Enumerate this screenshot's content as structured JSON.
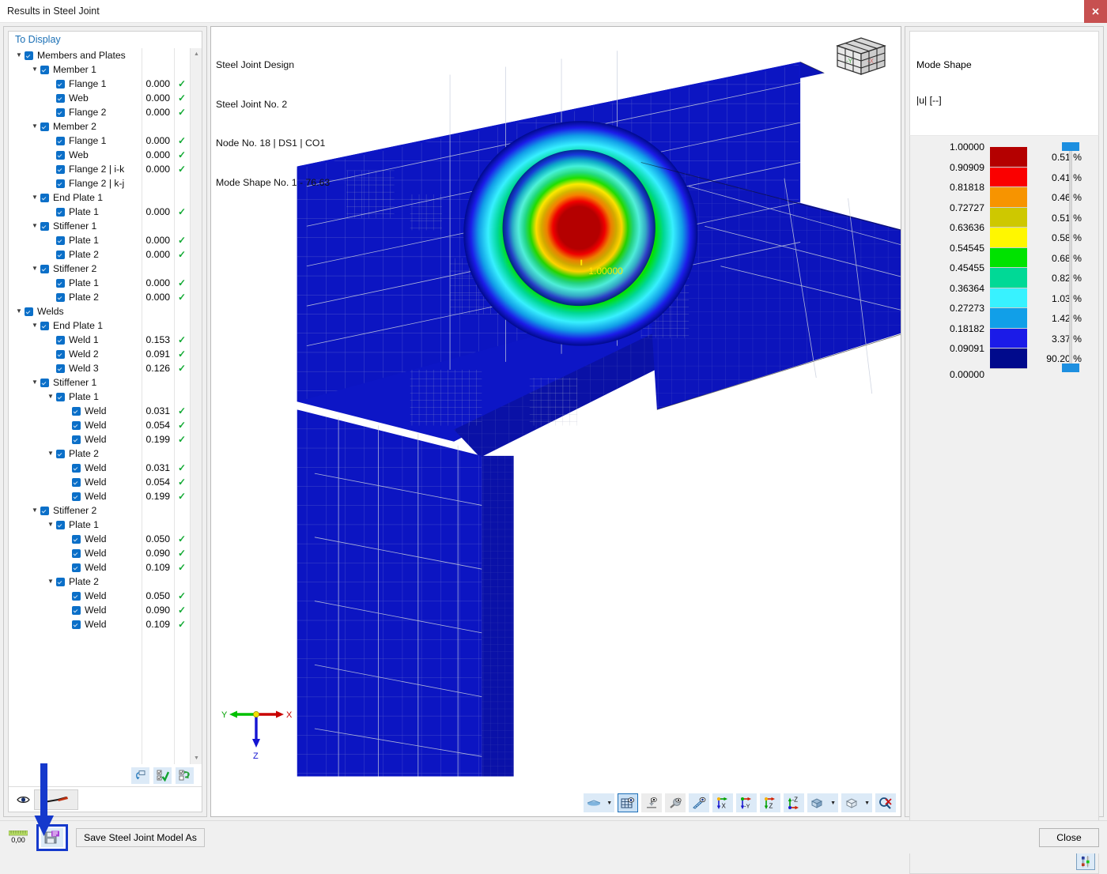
{
  "window": {
    "title": "Results in Steel Joint",
    "close_icon": "close-icon"
  },
  "left_panel": {
    "header": "To Display",
    "tree": [
      {
        "indent": 0,
        "twist": "v",
        "check": true,
        "label": "Members and Plates",
        "value": "",
        "ok": false
      },
      {
        "indent": 1,
        "twist": "v",
        "check": true,
        "label": "Member 1",
        "value": "",
        "ok": false
      },
      {
        "indent": 2,
        "twist": "",
        "check": true,
        "label": "Flange 1",
        "value": "0.000",
        "ok": true
      },
      {
        "indent": 2,
        "twist": "",
        "check": true,
        "label": "Web",
        "value": "0.000",
        "ok": true
      },
      {
        "indent": 2,
        "twist": "",
        "check": true,
        "label": "Flange 2",
        "value": "0.000",
        "ok": true
      },
      {
        "indent": 1,
        "twist": "v",
        "check": true,
        "label": "Member 2",
        "value": "",
        "ok": false
      },
      {
        "indent": 2,
        "twist": "",
        "check": true,
        "label": "Flange 1",
        "value": "0.000",
        "ok": true
      },
      {
        "indent": 2,
        "twist": "",
        "check": true,
        "label": "Web",
        "value": "0.000",
        "ok": true
      },
      {
        "indent": 2,
        "twist": "",
        "check": true,
        "label": "Flange 2 | i-k",
        "value": "0.000",
        "ok": true
      },
      {
        "indent": 2,
        "twist": "",
        "check": true,
        "label": "Flange 2 | k-j",
        "value": "",
        "ok": false
      },
      {
        "indent": 1,
        "twist": "v",
        "check": true,
        "label": "End Plate 1",
        "value": "",
        "ok": false
      },
      {
        "indent": 2,
        "twist": "",
        "check": true,
        "label": "Plate 1",
        "value": "0.000",
        "ok": true
      },
      {
        "indent": 1,
        "twist": "v",
        "check": true,
        "label": "Stiffener 1",
        "value": "",
        "ok": false
      },
      {
        "indent": 2,
        "twist": "",
        "check": true,
        "label": "Plate 1",
        "value": "0.000",
        "ok": true
      },
      {
        "indent": 2,
        "twist": "",
        "check": true,
        "label": "Plate 2",
        "value": "0.000",
        "ok": true
      },
      {
        "indent": 1,
        "twist": "v",
        "check": true,
        "label": "Stiffener 2",
        "value": "",
        "ok": false
      },
      {
        "indent": 2,
        "twist": "",
        "check": true,
        "label": "Plate 1",
        "value": "0.000",
        "ok": true
      },
      {
        "indent": 2,
        "twist": "",
        "check": true,
        "label": "Plate 2",
        "value": "0.000",
        "ok": true
      },
      {
        "indent": 0,
        "twist": "v",
        "check": true,
        "label": "Welds",
        "value": "",
        "ok": false
      },
      {
        "indent": 1,
        "twist": "v",
        "check": true,
        "label": "End Plate 1",
        "value": "",
        "ok": false
      },
      {
        "indent": 2,
        "twist": "",
        "check": true,
        "label": "Weld 1",
        "value": "0.153",
        "ok": true
      },
      {
        "indent": 2,
        "twist": "",
        "check": true,
        "label": "Weld 2",
        "value": "0.091",
        "ok": true
      },
      {
        "indent": 2,
        "twist": "",
        "check": true,
        "label": "Weld 3",
        "value": "0.126",
        "ok": true
      },
      {
        "indent": 1,
        "twist": "v",
        "check": true,
        "label": "Stiffener 1",
        "value": "",
        "ok": false
      },
      {
        "indent": 2,
        "twist": "v",
        "check": true,
        "label": "Plate 1",
        "value": "",
        "ok": false
      },
      {
        "indent": 3,
        "twist": "",
        "check": true,
        "label": "Weld",
        "value": "0.031",
        "ok": true
      },
      {
        "indent": 3,
        "twist": "",
        "check": true,
        "label": "Weld",
        "value": "0.054",
        "ok": true
      },
      {
        "indent": 3,
        "twist": "",
        "check": true,
        "label": "Weld",
        "value": "0.199",
        "ok": true
      },
      {
        "indent": 2,
        "twist": "v",
        "check": true,
        "label": "Plate 2",
        "value": "",
        "ok": false
      },
      {
        "indent": 3,
        "twist": "",
        "check": true,
        "label": "Weld",
        "value": "0.031",
        "ok": true
      },
      {
        "indent": 3,
        "twist": "",
        "check": true,
        "label": "Weld",
        "value": "0.054",
        "ok": true
      },
      {
        "indent": 3,
        "twist": "",
        "check": true,
        "label": "Weld",
        "value": "0.199",
        "ok": true
      },
      {
        "indent": 1,
        "twist": "v",
        "check": true,
        "label": "Stiffener 2",
        "value": "",
        "ok": false
      },
      {
        "indent": 2,
        "twist": "v",
        "check": true,
        "label": "Plate 1",
        "value": "",
        "ok": false
      },
      {
        "indent": 3,
        "twist": "",
        "check": true,
        "label": "Weld",
        "value": "0.050",
        "ok": true
      },
      {
        "indent": 3,
        "twist": "",
        "check": true,
        "label": "Weld",
        "value": "0.090",
        "ok": true
      },
      {
        "indent": 3,
        "twist": "",
        "check": true,
        "label": "Weld",
        "value": "0.109",
        "ok": true
      },
      {
        "indent": 2,
        "twist": "v",
        "check": true,
        "label": "Plate 2",
        "value": "",
        "ok": false
      },
      {
        "indent": 3,
        "twist": "",
        "check": true,
        "label": "Weld",
        "value": "0.050",
        "ok": true
      },
      {
        "indent": 3,
        "twist": "",
        "check": true,
        "label": "Weld",
        "value": "0.090",
        "ok": true
      },
      {
        "indent": 3,
        "twist": "",
        "check": true,
        "label": "Weld",
        "value": "0.109",
        "ok": true
      }
    ],
    "tools": [
      {
        "name": "reset-view-button",
        "icon": "reset-arrow-icon"
      },
      {
        "name": "select-all-button",
        "icon": "check-all-icon"
      },
      {
        "name": "invert-selection-button",
        "icon": "invert-selection-icon"
      }
    ],
    "footer": {
      "eye_icon": "visibility-eye-icon",
      "swatch_name": "weld-symbol-preview"
    }
  },
  "viewport": {
    "header_lines": [
      "Steel Joint Design",
      "Steel Joint No. 2",
      "Node No. 18 | DS1 | CO1",
      "Mode Shape No. 1 - 76.63"
    ],
    "peak_label": "1.00000",
    "nav_cube": {
      "label_x": "-X",
      "label_y": "-Y"
    },
    "axes": {
      "x": "X",
      "y": "Y",
      "z": "Z"
    },
    "toolbar": [
      {
        "name": "render-mode-button",
        "icon": "shading-icon",
        "caret": true,
        "selected": false,
        "flat": false
      },
      {
        "name": "show-mesh-button",
        "icon": "mesh-grid-icon",
        "caret": false,
        "selected": true,
        "flat": false
      },
      {
        "name": "show-supports-button",
        "icon": "support-icon",
        "caret": false,
        "selected": false,
        "flat": true
      },
      {
        "name": "show-loads-button",
        "icon": "load-pin-icon",
        "caret": false,
        "selected": false,
        "flat": true
      },
      {
        "name": "show-dimensions-button",
        "icon": "ruler-eye-icon",
        "caret": false,
        "selected": false,
        "flat": false
      },
      {
        "name": "view-in-x-button",
        "icon": "axis-x-icon",
        "caret": false,
        "selected": false,
        "flat": false
      },
      {
        "name": "view-in-negative-y-button",
        "icon": "axis-neg-y-icon",
        "caret": false,
        "selected": false,
        "flat": false
      },
      {
        "name": "view-in-z-button",
        "icon": "axis-z-icon",
        "caret": false,
        "selected": false,
        "flat": false
      },
      {
        "name": "view-in-negative-z-button",
        "icon": "axis-neg-z-icon",
        "caret": false,
        "selected": false,
        "flat": false
      },
      {
        "name": "perspective-button",
        "icon": "solid-blocks-icon",
        "caret": true,
        "selected": false,
        "flat": false
      },
      {
        "name": "wireframe-button",
        "icon": "wire-cube-icon",
        "caret": true,
        "selected": false,
        "flat": false
      },
      {
        "name": "zoom-reset-button",
        "icon": "zoom-cancel-icon",
        "caret": false,
        "selected": false,
        "flat": false
      }
    ]
  },
  "legend": {
    "title": "Mode Shape",
    "subtitle": "|u| [--]",
    "corner_button": "legend-settings-icon",
    "top_handle": "legend-upper-slider-handle",
    "bottom_handle": "legend-lower-slider-handle"
  },
  "chart_data": {
    "type": "heatmap",
    "title": "Mode Shape",
    "ylabel": "|u| [--]",
    "scale_labels": [
      "1.00000",
      "0.90909",
      "0.81818",
      "0.72727",
      "0.63636",
      "0.54545",
      "0.45455",
      "0.36364",
      "0.27273",
      "0.18182",
      "0.09091",
      "0.00000"
    ],
    "bands": [
      {
        "color": "#b40000",
        "percent": "0.51 %",
        "from": "0.90909",
        "to": "1.00000"
      },
      {
        "color": "#fa0000",
        "percent": "0.41 %",
        "from": "0.81818",
        "to": "0.90909"
      },
      {
        "color": "#f79400",
        "percent": "0.46 %",
        "from": "0.72727",
        "to": "0.81818"
      },
      {
        "color": "#cec800",
        "percent": "0.51 %",
        "from": "0.63636",
        "to": "0.72727"
      },
      {
        "color": "#fff700",
        "percent": "0.58 %",
        "from": "0.54545",
        "to": "0.63636"
      },
      {
        "color": "#00e300",
        "percent": "0.68 %",
        "from": "0.45455",
        "to": "0.54545"
      },
      {
        "color": "#00d996",
        "percent": "0.82 %",
        "from": "0.36364",
        "to": "0.45455"
      },
      {
        "color": "#38f2ff",
        "percent": "1.03 %",
        "from": "0.27273",
        "to": "0.36364"
      },
      {
        "color": "#119fe8",
        "percent": "1.42 %",
        "from": "0.18182",
        "to": "0.27273"
      },
      {
        "color": "#1b1be8",
        "percent": "3.37 %",
        "from": "0.09091",
        "to": "0.18182"
      },
      {
        "color": "#000a8c",
        "percent": "90.20 %",
        "from": "0.00000",
        "to": "0.09091"
      }
    ],
    "peak_value": "1.00000",
    "ylim": [
      0,
      1
    ]
  },
  "statusbar": {
    "units_value": "0,00",
    "save_icon": "save-model-icon",
    "save_as_label": "Save Steel Joint Model As",
    "close_label": "Close"
  }
}
